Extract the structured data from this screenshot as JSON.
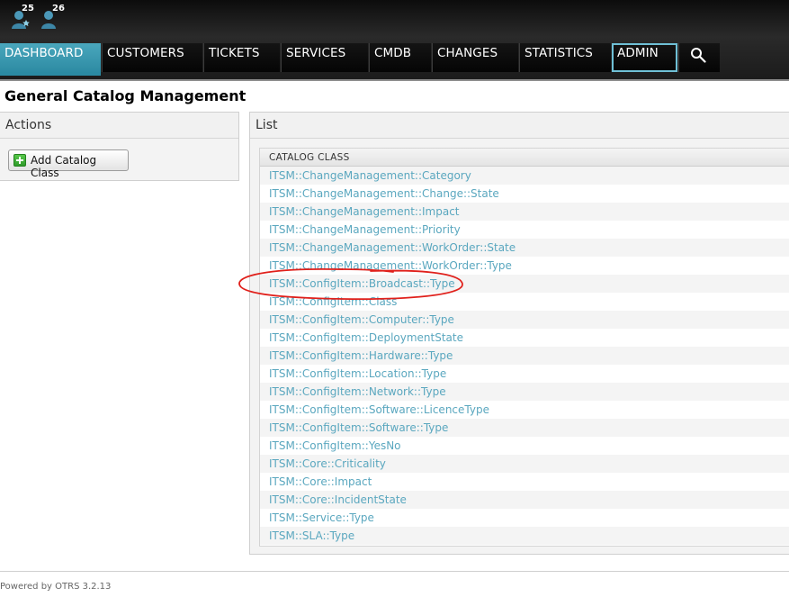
{
  "header": {
    "badges": [
      {
        "count": "25",
        "icon": "user-star-icon"
      },
      {
        "count": "26",
        "icon": "user-icon"
      }
    ],
    "nav": [
      {
        "label": "DASHBOARD",
        "state": "active"
      },
      {
        "label": "CUSTOMERS"
      },
      {
        "label": "TICKETS"
      },
      {
        "label": "SERVICES"
      },
      {
        "label": "CMDB"
      },
      {
        "label": "CHANGES"
      },
      {
        "label": "STATISTICS"
      },
      {
        "label": "ADMIN",
        "state": "highlighted"
      }
    ],
    "search_icon": "search-icon",
    "colors": {
      "active": "#3a9bb2",
      "highlight_border": "#6fc0d6"
    }
  },
  "page": {
    "title": "General Catalog Management"
  },
  "actions": {
    "heading": "Actions",
    "add_button": "Add Catalog Class",
    "add_icon": "plus-icon"
  },
  "list": {
    "heading": "List",
    "column": "CATALOG CLASS",
    "items": [
      "ITSM::ChangeManagement::Category",
      "ITSM::ChangeManagement::Change::State",
      "ITSM::ChangeManagement::Impact",
      "ITSM::ChangeManagement::Priority",
      "ITSM::ChangeManagement::WorkOrder::State",
      "ITSM::ChangeManagement::WorkOrder::Type",
      "ITSM::ConfigItem::Broadcast::Type",
      "ITSM::ConfigItem::Class",
      "ITSM::ConfigItem::Computer::Type",
      "ITSM::ConfigItem::DeploymentState",
      "ITSM::ConfigItem::Hardware::Type",
      "ITSM::ConfigItem::Location::Type",
      "ITSM::ConfigItem::Network::Type",
      "ITSM::ConfigItem::Software::LicenceType",
      "ITSM::ConfigItem::Software::Type",
      "ITSM::ConfigItem::YesNo",
      "ITSM::Core::Criticality",
      "ITSM::Core::Impact",
      "ITSM::Core::IncidentState",
      "ITSM::Service::Type",
      "ITSM::SLA::Type"
    ],
    "link_color": "#5aa7bf"
  },
  "footer": {
    "text": "Powered by OTRS 3.2.13"
  }
}
